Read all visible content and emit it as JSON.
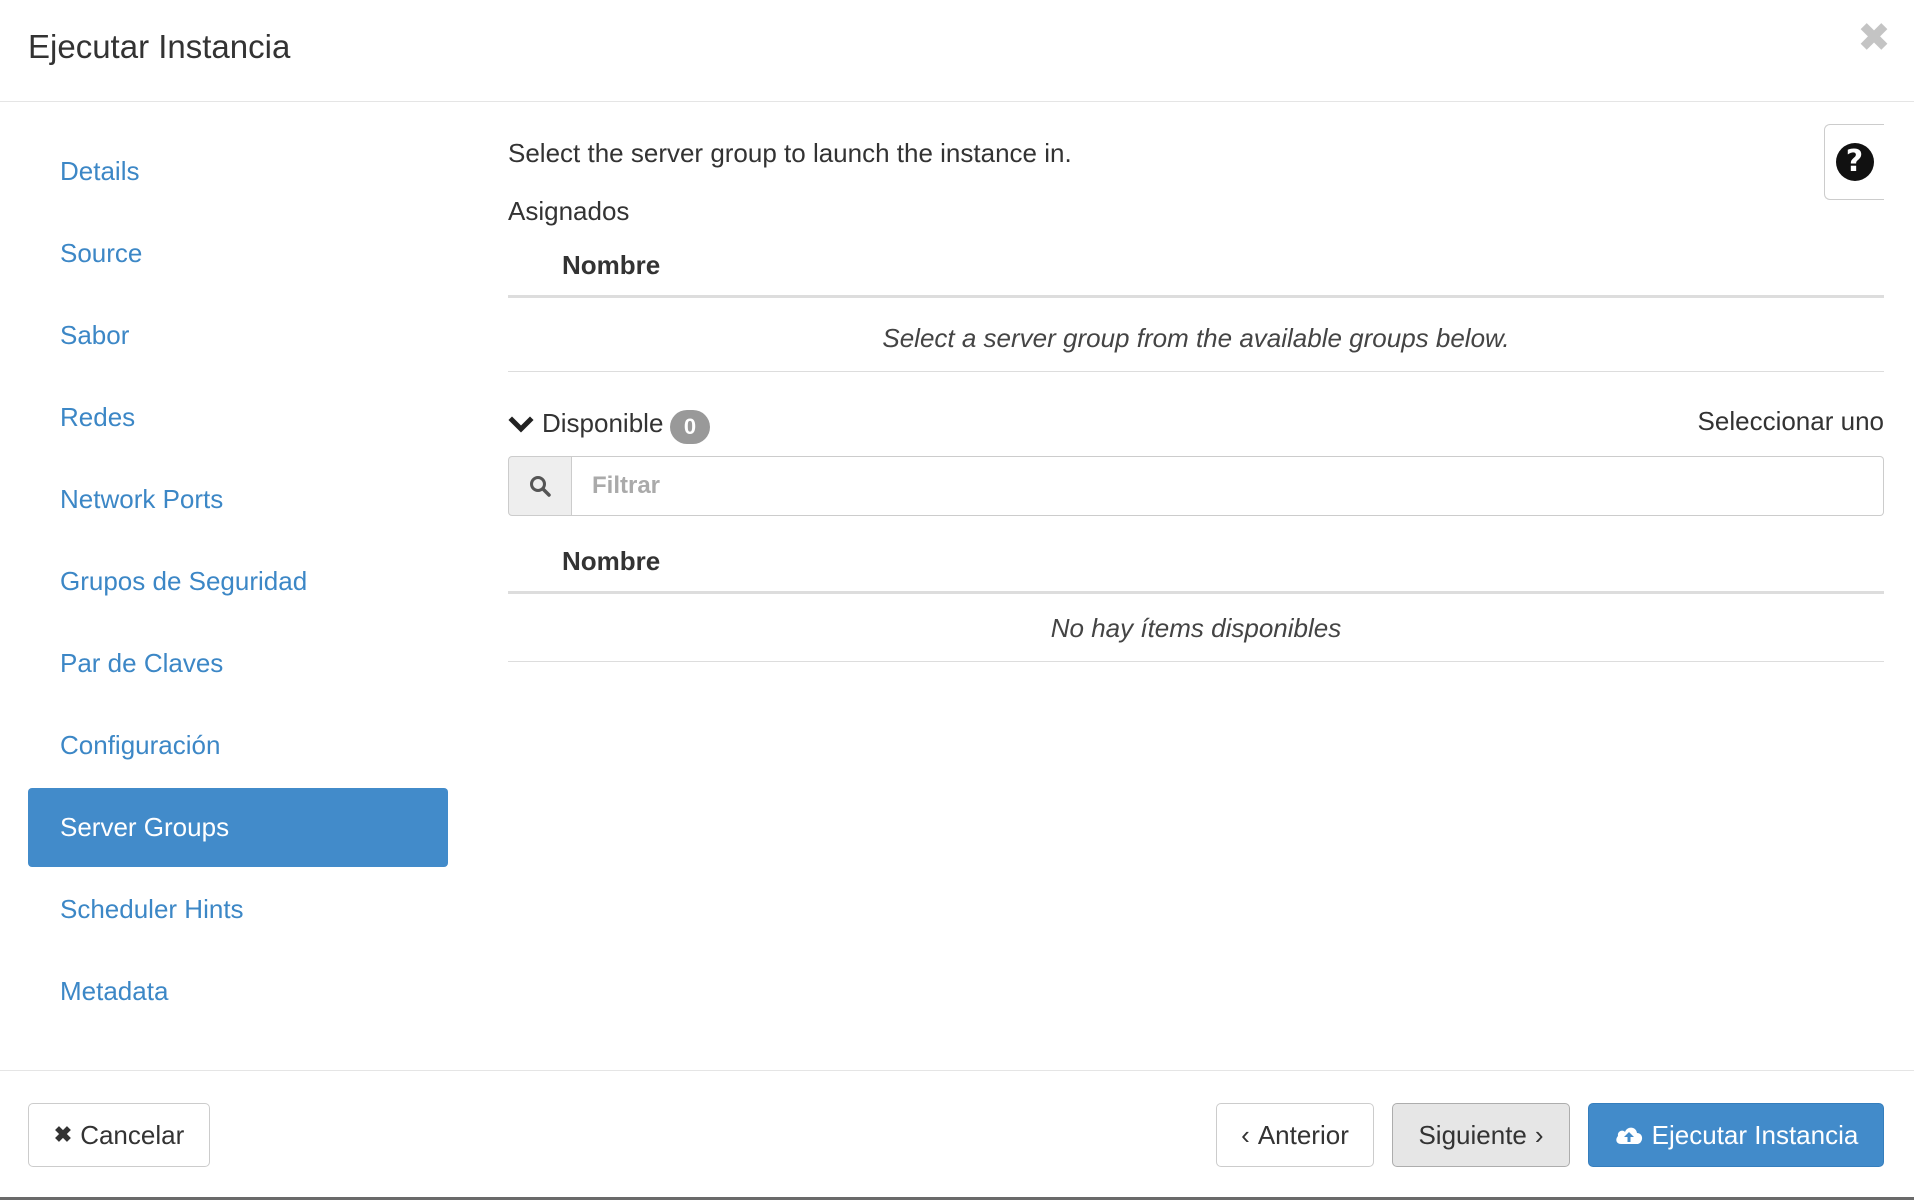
{
  "modal": {
    "title": "Ejecutar Instancia",
    "close_icon": "times-icon"
  },
  "sidebar": {
    "items": [
      {
        "label": "Details"
      },
      {
        "label": "Source"
      },
      {
        "label": "Sabor"
      },
      {
        "label": "Redes"
      },
      {
        "label": "Network Ports"
      },
      {
        "label": "Grupos de Seguridad"
      },
      {
        "label": "Par de Claves"
      },
      {
        "label": "Configuración"
      },
      {
        "label": "Server Groups",
        "active": true
      },
      {
        "label": "Scheduler Hints"
      },
      {
        "label": "Metadata"
      }
    ]
  },
  "main": {
    "help_icon": "question-circle-icon",
    "intro": "Select the server group to launch the instance in.",
    "allocated": {
      "label": "Asignados",
      "column_header": "Nombre",
      "empty_message": "Select a server group from the available groups below."
    },
    "available": {
      "label": "Disponible",
      "count": "0",
      "select_hint": "Seleccionar uno",
      "filter_placeholder": "Filtrar",
      "column_header": "Nombre",
      "empty_message": "No hay ítems disponibles"
    }
  },
  "footer": {
    "cancel_label": "Cancelar",
    "prev_label": "Anterior",
    "next_label": "Siguiente",
    "launch_label": "Ejecutar Instancia"
  },
  "colors": {
    "primary": "#428bca",
    "link": "#3c87c6",
    "badge": "#999999"
  }
}
